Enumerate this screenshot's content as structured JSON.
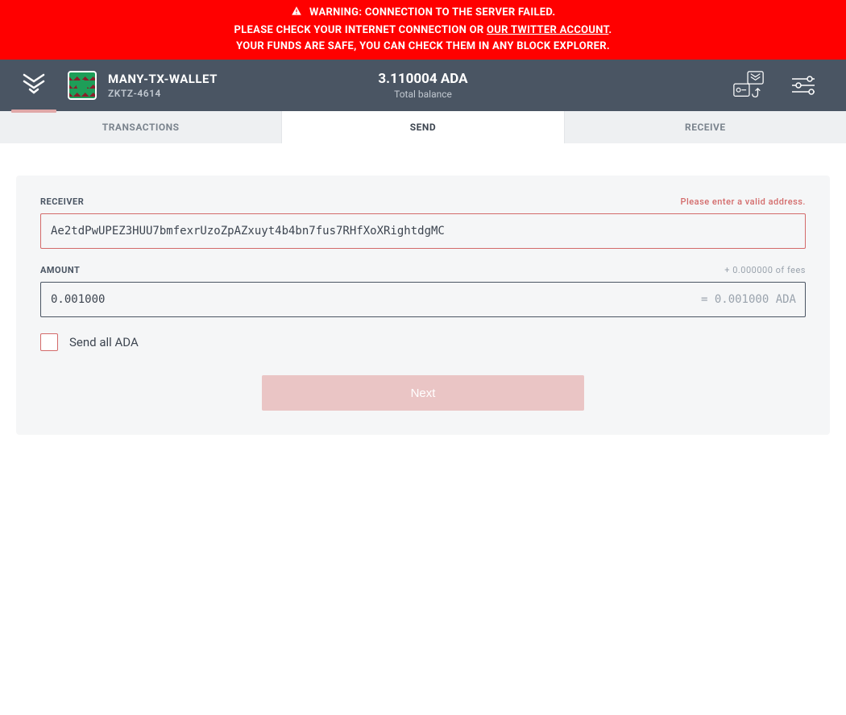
{
  "banner": {
    "line1": "WARNING: CONNECTION TO THE SERVER FAILED.",
    "line2_prefix": "PLEASE CHECK YOUR INTERNET CONNECTION OR ",
    "line2_link": "OUR TWITTER ACCOUNT",
    "line2_suffix": ".",
    "line3": "YOUR FUNDS ARE SAFE, YOU CAN CHECK THEM IN ANY BLOCK EXPLORER."
  },
  "header": {
    "wallet_name": "MANY-TX-WALLET",
    "wallet_sub": "ZKTZ-4614",
    "balance": "3.110004 ADA",
    "balance_label": "Total balance"
  },
  "tabs": {
    "transactions": "TRANSACTIONS",
    "send": "SEND",
    "receive": "RECEIVE"
  },
  "form": {
    "receiver_label": "RECEIVER",
    "receiver_error": "Please enter a valid address.",
    "receiver_value": "Ae2tdPwUPEZ3HUU7bmfexrUzoZpAZxuyt4b4bn7fus7RHfXoXRightdgMC",
    "amount_label": "AMOUNT",
    "amount_fees": "+ 0.000000 of fees",
    "amount_value": "0.001000",
    "amount_suffix": "= 0.001000 ADA",
    "send_all_label": "Send all ADA",
    "next_label": "Next"
  },
  "colors": {
    "banner_bg": "#ff0000",
    "header_bg": "#4a5563",
    "error": "#d36a6a",
    "button_disabled": "#eac5c5",
    "card_bg": "#f5f6f7"
  }
}
